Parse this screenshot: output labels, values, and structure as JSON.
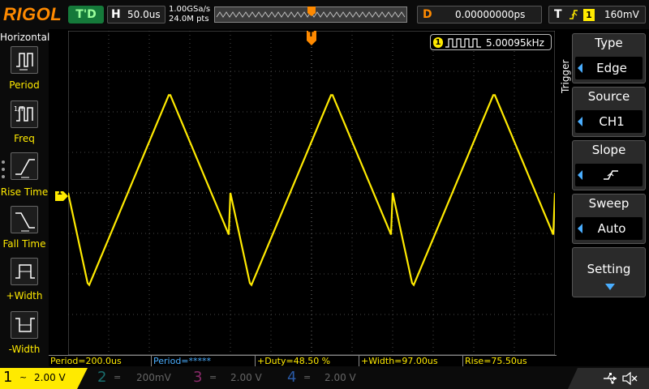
{
  "header": {
    "brand": "RIGOL",
    "run_status": "T'D",
    "horizontal_key": "H",
    "timebase": "50.0us",
    "sample_rate": "1.00GSa/s",
    "memory_depth": "24.0M pts",
    "delay_key": "D",
    "delay_value": "0.00000000ps",
    "trigger_key": "T",
    "trigger_source_badge": "1",
    "trigger_level": "160mV"
  },
  "left_menu": {
    "title": "Horizontal",
    "items": [
      {
        "label": "Period",
        "icon": "period-icon"
      },
      {
        "label": "Freq",
        "icon": "frequency-icon"
      },
      {
        "label": "Rise Time",
        "icon": "rise-time-icon"
      },
      {
        "label": "Fall Time",
        "icon": "fall-time-icon"
      },
      {
        "label": "+Width",
        "icon": "positive-width-icon"
      },
      {
        "label": "-Width",
        "icon": "negative-width-icon"
      }
    ]
  },
  "waveform": {
    "channel_badge": "1",
    "trigger_marker": "T",
    "frequency_channel": "1",
    "frequency_readout": "5.00095kHz",
    "color": "#ffea00"
  },
  "right_menu": {
    "title": "Trigger",
    "items": [
      {
        "title": "Type",
        "value": "Edge"
      },
      {
        "title": "Source",
        "value": "CH1"
      },
      {
        "title": "Slope",
        "value": "",
        "icon": "rising-edge-icon"
      },
      {
        "title": "Sweep",
        "value": "Auto"
      },
      {
        "title": "Setting",
        "value": "",
        "icon": "chevron-down-icon"
      }
    ]
  },
  "measurements": [
    "Period=200.0us",
    "Period=*****",
    "+Duty=48.50 %",
    "+Width=97.00us",
    "Rise=75.50us"
  ],
  "channels": [
    {
      "number": "1",
      "coupling": "~",
      "scale": "2.00 V",
      "color": "#ffea00"
    },
    {
      "number": "2",
      "coupling": "=",
      "scale": "200mV",
      "color": "#1a8f8f"
    },
    {
      "number": "3",
      "coupling": "=",
      "scale": "2.00 V",
      "color": "#c0308f"
    },
    {
      "number": "4",
      "coupling": "=",
      "scale": "2.00 V",
      "color": "#2a6fd6"
    }
  ],
  "status_icons": [
    "usb-icon",
    "speaker-muted-icon"
  ]
}
